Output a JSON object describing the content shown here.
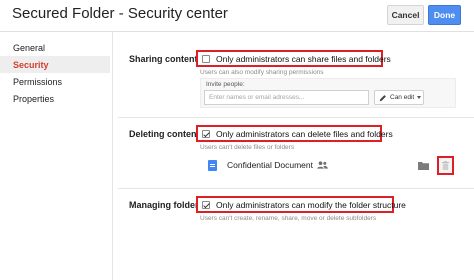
{
  "header": {
    "title": "Secured Folder - Security center",
    "cancel_label": "Cancel",
    "done_label": "Done"
  },
  "sidebar": {
    "items": [
      {
        "label": "General",
        "active": false
      },
      {
        "label": "Security",
        "active": true
      },
      {
        "label": "Permissions",
        "active": false
      },
      {
        "label": "Properties",
        "active": false
      }
    ]
  },
  "sharing": {
    "section_label": "Sharing content",
    "option_label": "Only administrators can share files and folders",
    "checked": false,
    "helper": "Users can also modify sharing permissions",
    "invite_label": "Invite people:",
    "invite_placeholder": "Enter names or email adresses...",
    "permission_label": "Can edit"
  },
  "deleting": {
    "section_label": "Deleting content",
    "option_label": "Only administrators can delete files and folders",
    "checked": true,
    "helper": "Users can't delete files or folders",
    "document_name": "Confidential Document"
  },
  "managing": {
    "section_label": "Managing folders",
    "option_label": "Only administrators can modify the folder structure",
    "checked": true,
    "helper": "Users can't create, rename, share, move or delete subfolders"
  },
  "icons": {
    "document": "doc-icon",
    "shared": "people-icon",
    "folder": "folder-icon",
    "delete": "trash-icon",
    "edit": "pencil-icon"
  },
  "colors": {
    "accent_red": "#d23f31",
    "highlight_border": "#dd1f26",
    "primary_blue": "#4d8ef0",
    "doc_blue": "#4285f4"
  }
}
